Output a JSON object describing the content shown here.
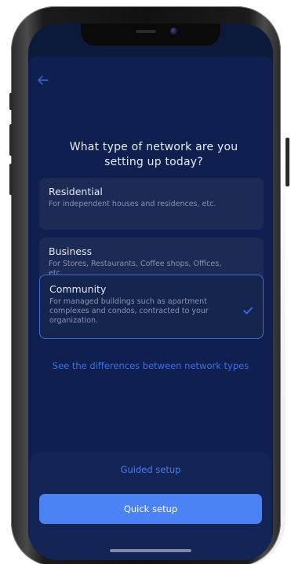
{
  "screen": {
    "title": "What type of network are you setting up today?",
    "options": [
      {
        "title": "Residential",
        "description": "For independent houses and residences, etc.",
        "selected": false
      },
      {
        "title": "Business",
        "description": "For Stores, Restaurants, Coffee shops, Offices, etc.",
        "selected": false
      },
      {
        "title": "Community",
        "description": "For managed buildings such as apartment complexes and condos, contracted to your organization.",
        "selected": true
      }
    ],
    "differences_link": "See the differences between network types",
    "guided_setup_label": "Guided setup",
    "quick_setup_label": "Quick setup"
  },
  "icons": {
    "back": "arrow-left-icon",
    "selected": "check-icon"
  },
  "colors": {
    "background": "#0b1a3b",
    "sheet": "#0f2050",
    "card": "#1c2a55",
    "accent": "#4b82f4",
    "link": "#3f6fe6",
    "text_primary": "#e8ecf6",
    "text_secondary": "#8a93ad"
  }
}
